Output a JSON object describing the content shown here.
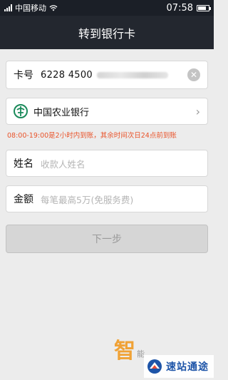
{
  "status_bar": {
    "carrier": "中国移动",
    "time": "07:58",
    "battery_level": 0.8
  },
  "nav": {
    "title": "转到银行卡"
  },
  "card_number": {
    "label": "卡号",
    "value": "6228 4500",
    "clear_icon": "clear-icon"
  },
  "bank": {
    "name": "中国农业银行",
    "logo_color": "#1a8a5a"
  },
  "notice": {
    "text": "08:00-19:00是2小时内到账，其余时间次日24点前到账",
    "color": "#e9532a"
  },
  "payee_name": {
    "label": "姓名",
    "placeholder": "收款人姓名"
  },
  "amount": {
    "label": "金额",
    "placeholder": "每笔最高5万(免服务费)"
  },
  "next_button": {
    "label": "下一步"
  },
  "watermarks": {
    "left_char": "智",
    "left_small": "能",
    "right_text": "速站通途"
  }
}
